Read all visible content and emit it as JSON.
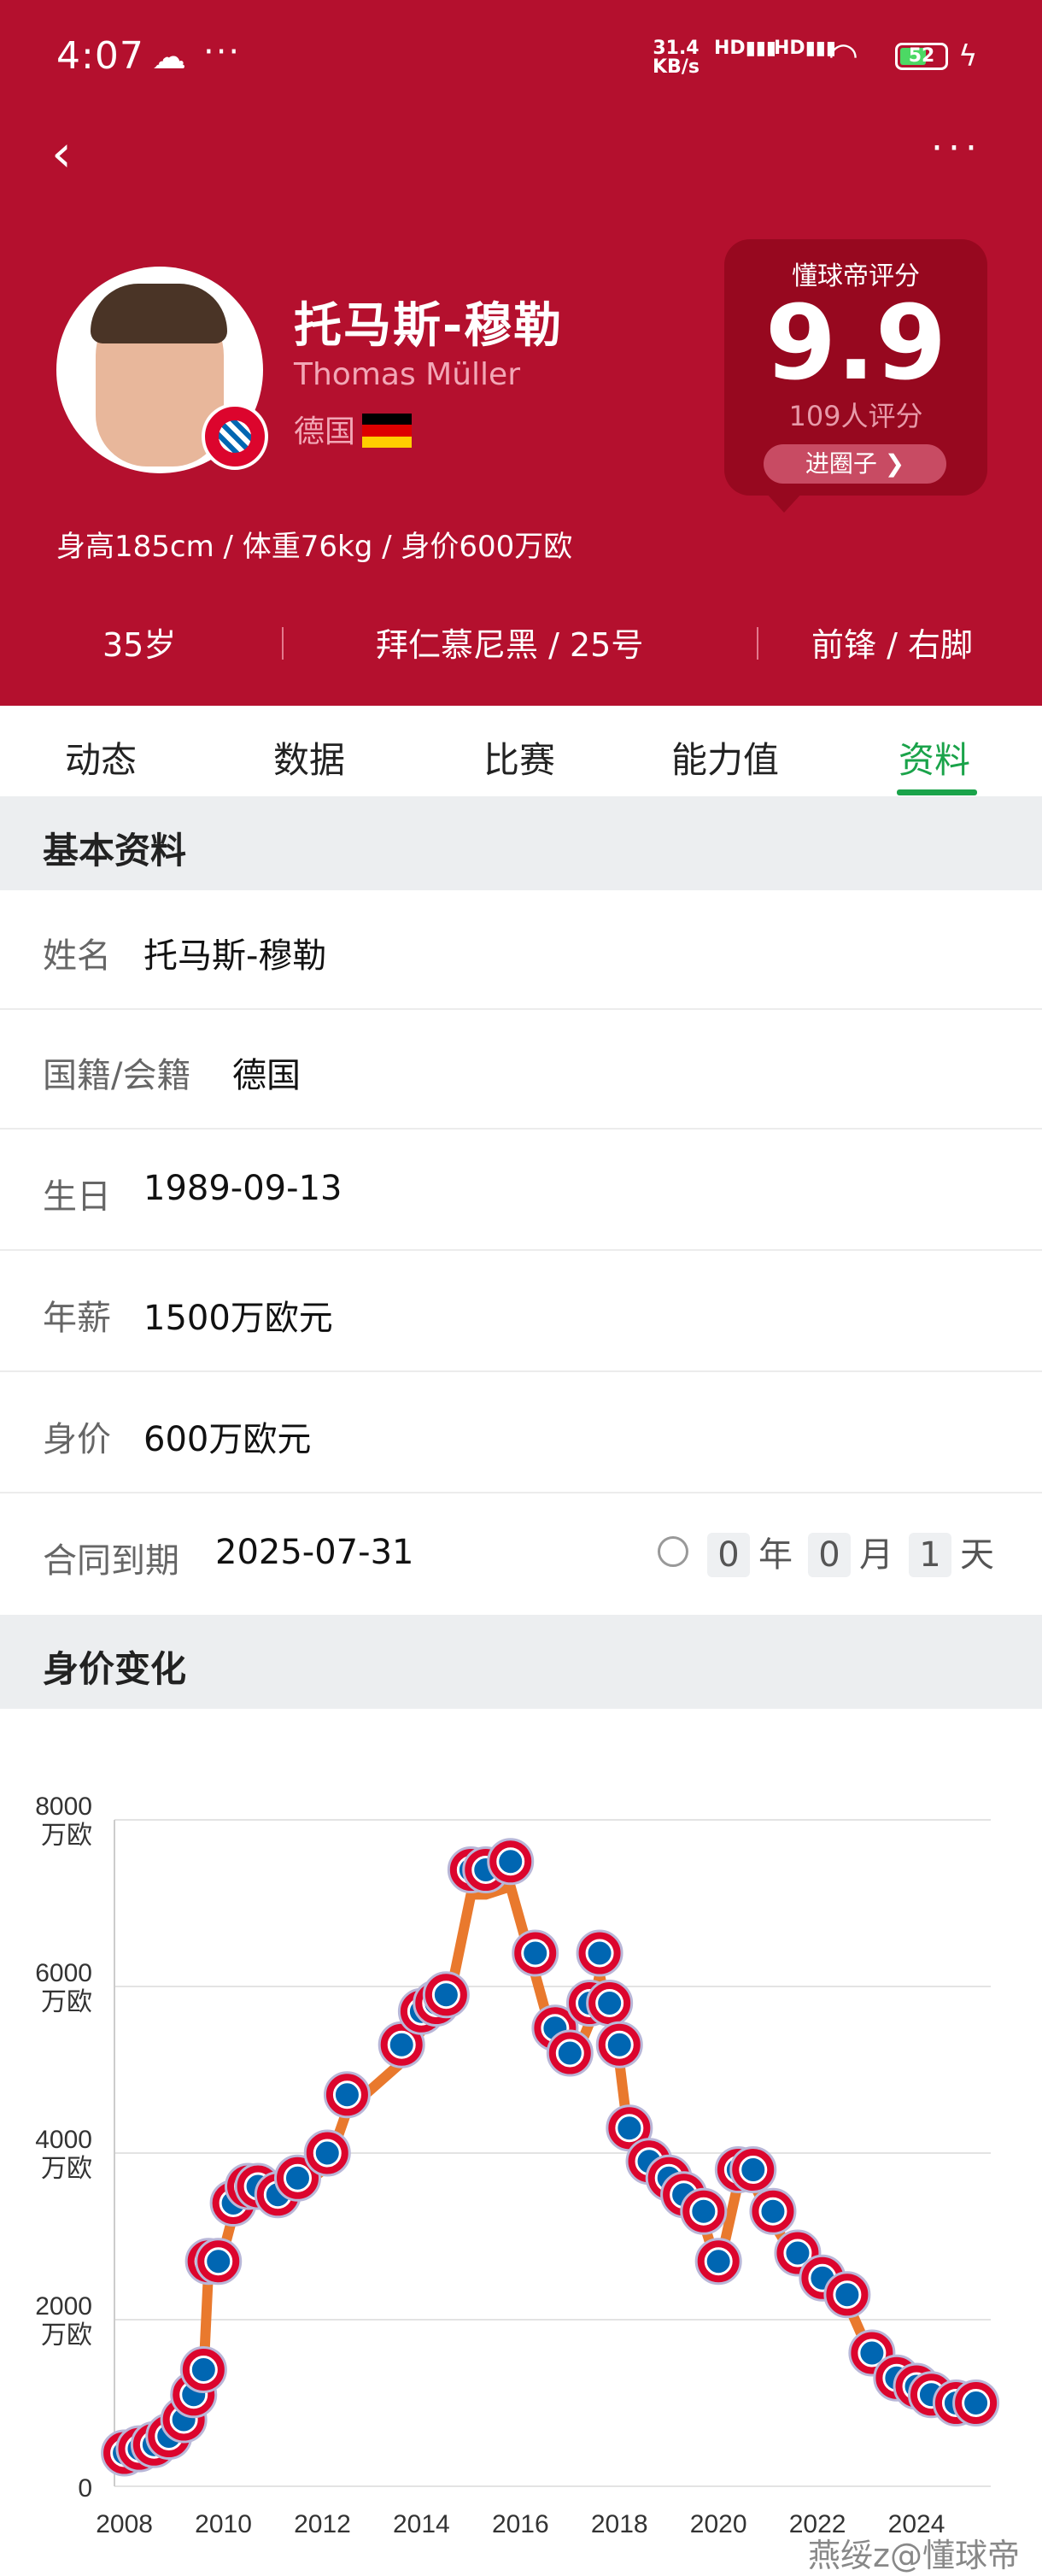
{
  "status_bar": {
    "time": "4:07",
    "weather_icon": "partly-cloudy-icon",
    "net_speed": "31.4",
    "net_unit": "KB/s",
    "sig1": "HD",
    "sig2": "HD",
    "battery": "52"
  },
  "nav": {
    "back_icon": "chevron-left-icon",
    "more_icon": "more-dots-icon"
  },
  "profile": {
    "name_cn": "托马斯-穆勒",
    "name_en": "Thomas Müller",
    "nation": "德国",
    "bio": "身高185cm / 体重76kg / 身价600万欧",
    "age": "35岁",
    "club_number": "拜仁慕尼黑 / 25号",
    "position_foot": "前锋 / 右脚",
    "flag_colors": [
      "#000000",
      "#dd0000",
      "#ffce00"
    ]
  },
  "rating": {
    "label": "懂球帝评分",
    "score": "9.9",
    "count": "109人评分",
    "button": "进圈子 ❯"
  },
  "tabs": [
    {
      "label": "动态",
      "active": false
    },
    {
      "label": "数据",
      "active": false
    },
    {
      "label": "比赛",
      "active": false
    },
    {
      "label": "能力值",
      "active": false
    },
    {
      "label": "资料",
      "active": true
    }
  ],
  "basic": {
    "title": "基本资料",
    "rows": [
      {
        "key": "姓名",
        "value": "托马斯-穆勒"
      },
      {
        "key": "国籍/会籍",
        "value": "德国"
      },
      {
        "key": "生日",
        "value": "1989-09-13"
      },
      {
        "key": "年薪",
        "value": "1500万欧元"
      },
      {
        "key": "身价",
        "value": "600万欧元"
      },
      {
        "key": "合同到期",
        "value": "2025-07-31"
      }
    ],
    "countdown": {
      "years": "0",
      "year_unit": "年",
      "months": "0",
      "month_unit": "月",
      "days": "1",
      "day_unit": "天"
    }
  },
  "value_section": {
    "title": "身价变化"
  },
  "chart_data": {
    "type": "line",
    "title": "",
    "y_ticks": [
      "0",
      "2000",
      "4000",
      "6000",
      "8000"
    ],
    "y_unit": "万欧",
    "x_ticks": [
      "2008",
      "2010",
      "2012",
      "2014",
      "2016",
      "2018",
      "2020",
      "2022",
      "2024"
    ],
    "ylim": [
      0,
      8000
    ],
    "xlim": [
      2007.8,
      2025.5
    ],
    "line_color": "#e9792d",
    "marker": "fc-bayern-badge",
    "x": [
      2008.0,
      2008.3,
      2008.6,
      2008.9,
      2009.2,
      2009.4,
      2009.6,
      2009.7,
      2009.9,
      2010.2,
      2010.5,
      2010.7,
      2011.1,
      2011.5,
      2012.1,
      2012.5,
      2013.6,
      2014.0,
      2014.3,
      2014.5,
      2015.0,
      2015.3,
      2015.8,
      2016.3,
      2016.7,
      2017.0,
      2017.4,
      2017.6,
      2017.8,
      2018.0,
      2018.2,
      2018.6,
      2019.0,
      2019.3,
      2019.7,
      2020.0,
      2020.4,
      2020.7,
      2021.1,
      2021.6,
      2022.1,
      2022.6,
      2023.1,
      2023.6,
      2024.0,
      2024.3,
      2024.8,
      2025.2
    ],
    "values": [
      400,
      450,
      500,
      600,
      800,
      1100,
      1400,
      2700,
      2700,
      3400,
      3600,
      3600,
      3500,
      3700,
      4000,
      4700,
      5300,
      5700,
      5800,
      5900,
      7400,
      7400,
      7500,
      6400,
      5500,
      5200,
      5800,
      6400,
      5800,
      5300,
      4300,
      3900,
      3700,
      3500,
      3300,
      2700,
      3800,
      3800,
      3300,
      2800,
      2500,
      2300,
      1600,
      1300,
      1200,
      1100,
      1000,
      1000
    ]
  },
  "watermark": "燕绥z@懂球帝"
}
